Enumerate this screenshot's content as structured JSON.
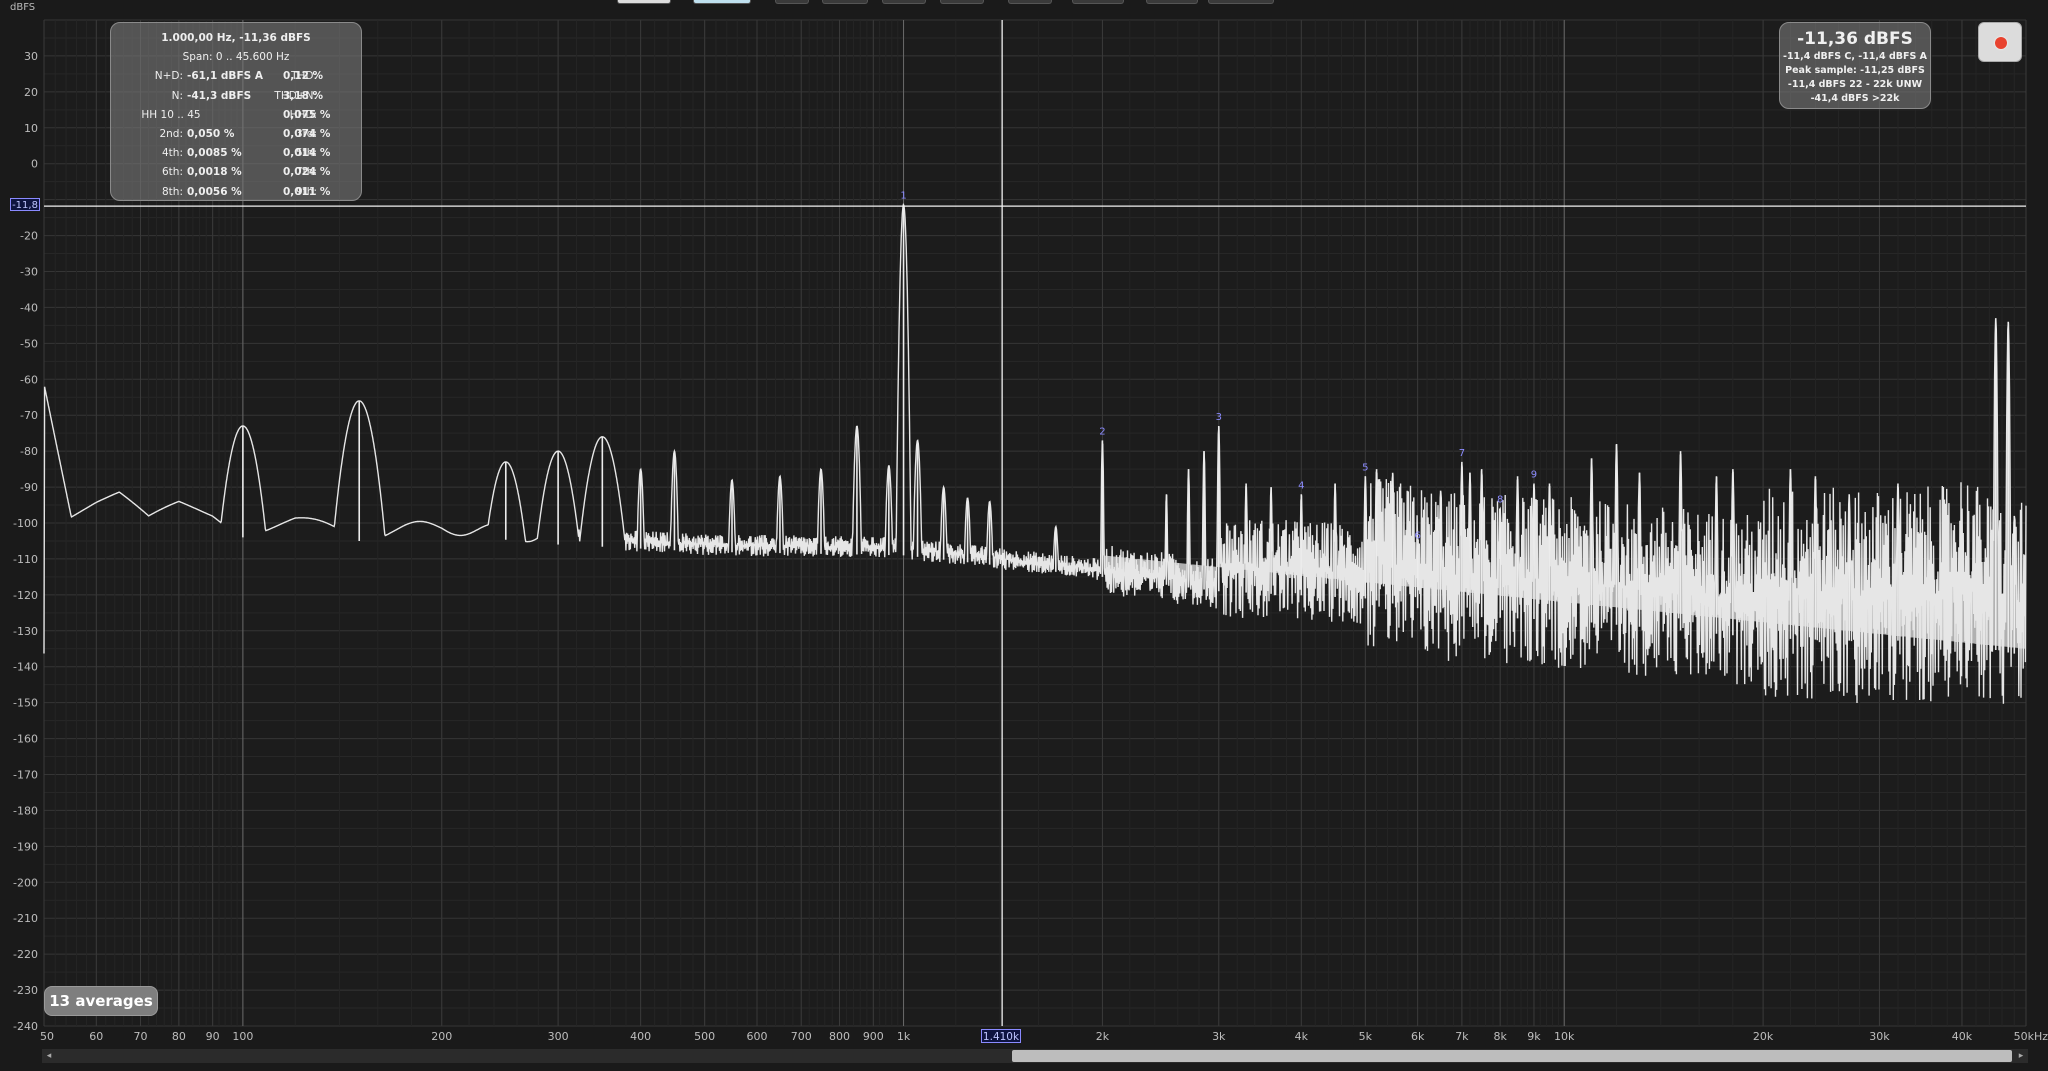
{
  "toolbar": {
    "buttons": [
      "",
      "",
      "",
      "",
      "",
      "",
      "",
      "",
      "",
      "",
      ""
    ]
  },
  "y_unit": "dBFS",
  "info_panel": {
    "header": "1.000,00 Hz, -11,36 dBFS",
    "span": "Span: 0 .. 45.600 Hz",
    "rows": [
      {
        "l_label": "N+D:",
        "l_value": "-61,1 dBFS A",
        "r_label": "THD:",
        "r_value": "0,12 %"
      },
      {
        "l_label": "N:",
        "l_value": "-41,3 dBFS",
        "r_label": "THD+N:",
        "r_value": "3,18 %"
      },
      {
        "l_label": "HH 10 .. 45",
        "l_value": "",
        "r_label": "HHD:",
        "r_value": "0,075 %"
      },
      {
        "l_label": "2nd:",
        "l_value": "0,050 %",
        "r_label": "3rd:",
        "r_value": "0,074 %"
      },
      {
        "l_label": "4th:",
        "l_value": "0,0085 %",
        "r_label": "5th:",
        "r_value": "0,014 %"
      },
      {
        "l_label": "6th:",
        "l_value": "0,0018 %",
        "r_label": "7th:",
        "r_value": "0,024 %"
      },
      {
        "l_label": "8th:",
        "l_value": "0,0056 %",
        "r_label": "9th:",
        "r_value": "0,011 %"
      }
    ]
  },
  "level_panel": {
    "main": "-11,36 dBFS",
    "lines": [
      "-11,4 dBFS C, -11,4 dBFS A",
      "Peak sample: -11,25 dBFS",
      "-11,4 dBFS 22 - 22k UNW",
      "-41,4 dBFS >22k"
    ]
  },
  "record_icon": "record-icon",
  "averages_label": "13 averages",
  "cursor": {
    "y_label": "-11,8",
    "x_label": "1.410k",
    "y_value": -11.8,
    "x_value": 1410
  },
  "scrollbar": {
    "left_arrow": "◂",
    "right_arrow": "▸"
  },
  "chart_data": {
    "type": "line",
    "xscale": "log",
    "xlim": [
      50,
      50000
    ],
    "ylim": [
      -240,
      40
    ],
    "grid": true,
    "x_ticks": [
      {
        "v": 50,
        "l": "50"
      },
      {
        "v": 60,
        "l": "60"
      },
      {
        "v": 70,
        "l": "70"
      },
      {
        "v": 80,
        "l": "80"
      },
      {
        "v": 90,
        "l": "90"
      },
      {
        "v": 100,
        "l": "100"
      },
      {
        "v": 200,
        "l": "200"
      },
      {
        "v": 300,
        "l": "300"
      },
      {
        "v": 400,
        "l": "400"
      },
      {
        "v": 500,
        "l": "500"
      },
      {
        "v": 600,
        "l": "600"
      },
      {
        "v": 700,
        "l": "700"
      },
      {
        "v": 800,
        "l": "800"
      },
      {
        "v": 900,
        "l": "900"
      },
      {
        "v": 1000,
        "l": "1k"
      },
      {
        "v": 2000,
        "l": "2k"
      },
      {
        "v": 3000,
        "l": "3k"
      },
      {
        "v": 4000,
        "l": "4k"
      },
      {
        "v": 5000,
        "l": "5k"
      },
      {
        "v": 6000,
        "l": "6k"
      },
      {
        "v": 7000,
        "l": "7k"
      },
      {
        "v": 8000,
        "l": "8k"
      },
      {
        "v": 9000,
        "l": "9k"
      },
      {
        "v": 10000,
        "l": "10k"
      },
      {
        "v": 20000,
        "l": "20k"
      },
      {
        "v": 30000,
        "l": "30k"
      },
      {
        "v": 40000,
        "l": "40k"
      },
      {
        "v": 50000,
        "l": "50kHz"
      }
    ],
    "y_ticks": [
      30,
      20,
      10,
      0,
      -20,
      -30,
      -40,
      -50,
      -60,
      -70,
      -80,
      -90,
      -100,
      -110,
      -120,
      -130,
      -140,
      -150,
      -160,
      -170,
      -180,
      -190,
      -200,
      -210,
      -220,
      -230,
      -240
    ],
    "harmonics": [
      {
        "label": "1",
        "freq": 1000,
        "level": -11.4
      },
      {
        "label": "2",
        "freq": 2000,
        "level": -77
      },
      {
        "label": "3",
        "freq": 3000,
        "level": -73
      },
      {
        "label": "4",
        "freq": 4000,
        "level": -92
      },
      {
        "label": "5",
        "freq": 5000,
        "level": -87
      },
      {
        "label": "6",
        "freq": 6000,
        "level": -106
      },
      {
        "label": "7",
        "freq": 7000,
        "level": -83
      },
      {
        "label": "8",
        "freq": 8000,
        "level": -96
      },
      {
        "label": "9",
        "freq": 9000,
        "level": -89
      }
    ],
    "spurs": [
      [
        100,
        -73
      ],
      [
        150,
        -66
      ],
      [
        250,
        -83
      ],
      [
        300,
        -80
      ],
      [
        350,
        -76
      ],
      [
        400,
        -85
      ],
      [
        450,
        -80
      ],
      [
        550,
        -88
      ],
      [
        650,
        -87
      ],
      [
        750,
        -85
      ],
      [
        850,
        -73
      ],
      [
        950,
        -84
      ],
      [
        1050,
        -77
      ],
      [
        1150,
        -90
      ],
      [
        1250,
        -93
      ],
      [
        1350,
        -94
      ],
      [
        1700,
        -101
      ],
      [
        2500,
        -92
      ],
      [
        2700,
        -85
      ],
      [
        2850,
        -80
      ],
      [
        3300,
        -89
      ],
      [
        3600,
        -90
      ],
      [
        4500,
        -89
      ],
      [
        5200,
        -85
      ],
      [
        5500,
        -86
      ],
      [
        6500,
        -91
      ],
      [
        7200,
        -86
      ],
      [
        7500,
        -85
      ],
      [
        8500,
        -87
      ],
      [
        9500,
        -89
      ],
      [
        11000,
        -82
      ],
      [
        12000,
        -78
      ],
      [
        13000,
        -86
      ],
      [
        15000,
        -80
      ],
      [
        17000,
        -87
      ],
      [
        18000,
        -85
      ],
      [
        22000,
        -85
      ],
      [
        24000,
        -87
      ],
      [
        27000,
        -92
      ],
      [
        32000,
        -89
      ],
      [
        45000,
        -43
      ],
      [
        47000,
        -44
      ],
      [
        48000,
        -98
      ]
    ],
    "noise_floor": [
      [
        50,
        -60
      ],
      [
        55,
        -98
      ],
      [
        60,
        -95
      ],
      [
        65,
        -93
      ],
      [
        72,
        -100
      ],
      [
        80,
        -95
      ],
      [
        90,
        -97
      ],
      [
        100,
        -102
      ],
      [
        120,
        -100
      ],
      [
        150,
        -103
      ],
      [
        200,
        -101
      ],
      [
        300,
        -104
      ],
      [
        500,
        -106
      ],
      [
        1000,
        -107
      ],
      [
        2000,
        -113
      ],
      [
        3000,
        -117
      ],
      [
        5000,
        -119
      ],
      [
        7000,
        -124
      ],
      [
        10000,
        -125
      ],
      [
        20000,
        -130
      ],
      [
        30000,
        -131
      ],
      [
        38000,
        -130
      ],
      [
        40000,
        -125
      ],
      [
        44000,
        -133
      ],
      [
        50000,
        -135
      ]
    ]
  }
}
